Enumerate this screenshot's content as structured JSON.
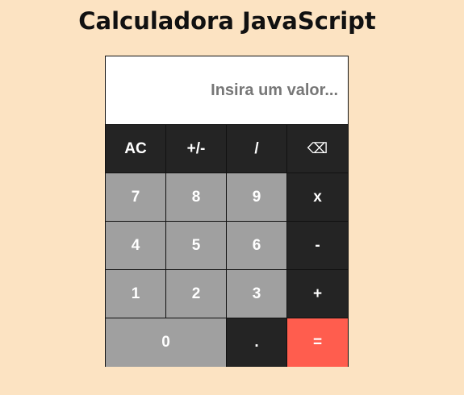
{
  "page": {
    "title": "Calculadora JavaScript"
  },
  "display": {
    "value": "",
    "placeholder": "Insira um valor..."
  },
  "keys": {
    "clear": "AC",
    "toggle_sign": "+/-",
    "divide": "/",
    "backspace_icon": "backspace-icon",
    "backspace_glyph": "⌫",
    "seven": "7",
    "eight": "8",
    "nine": "9",
    "multiply": "x",
    "four": "4",
    "five": "5",
    "six": "6",
    "subtract": "-",
    "one": "1",
    "two": "2",
    "three": "3",
    "add": "+",
    "zero": "0",
    "decimal": ".",
    "equals": "="
  },
  "colors": {
    "background": "#fce3c2",
    "operator_key": "#242424",
    "number_key": "#a0a0a0",
    "equals_key": "#ff5d4e",
    "key_text": "#ffffff",
    "display_bg": "#ffffff",
    "placeholder_text": "#777777"
  }
}
